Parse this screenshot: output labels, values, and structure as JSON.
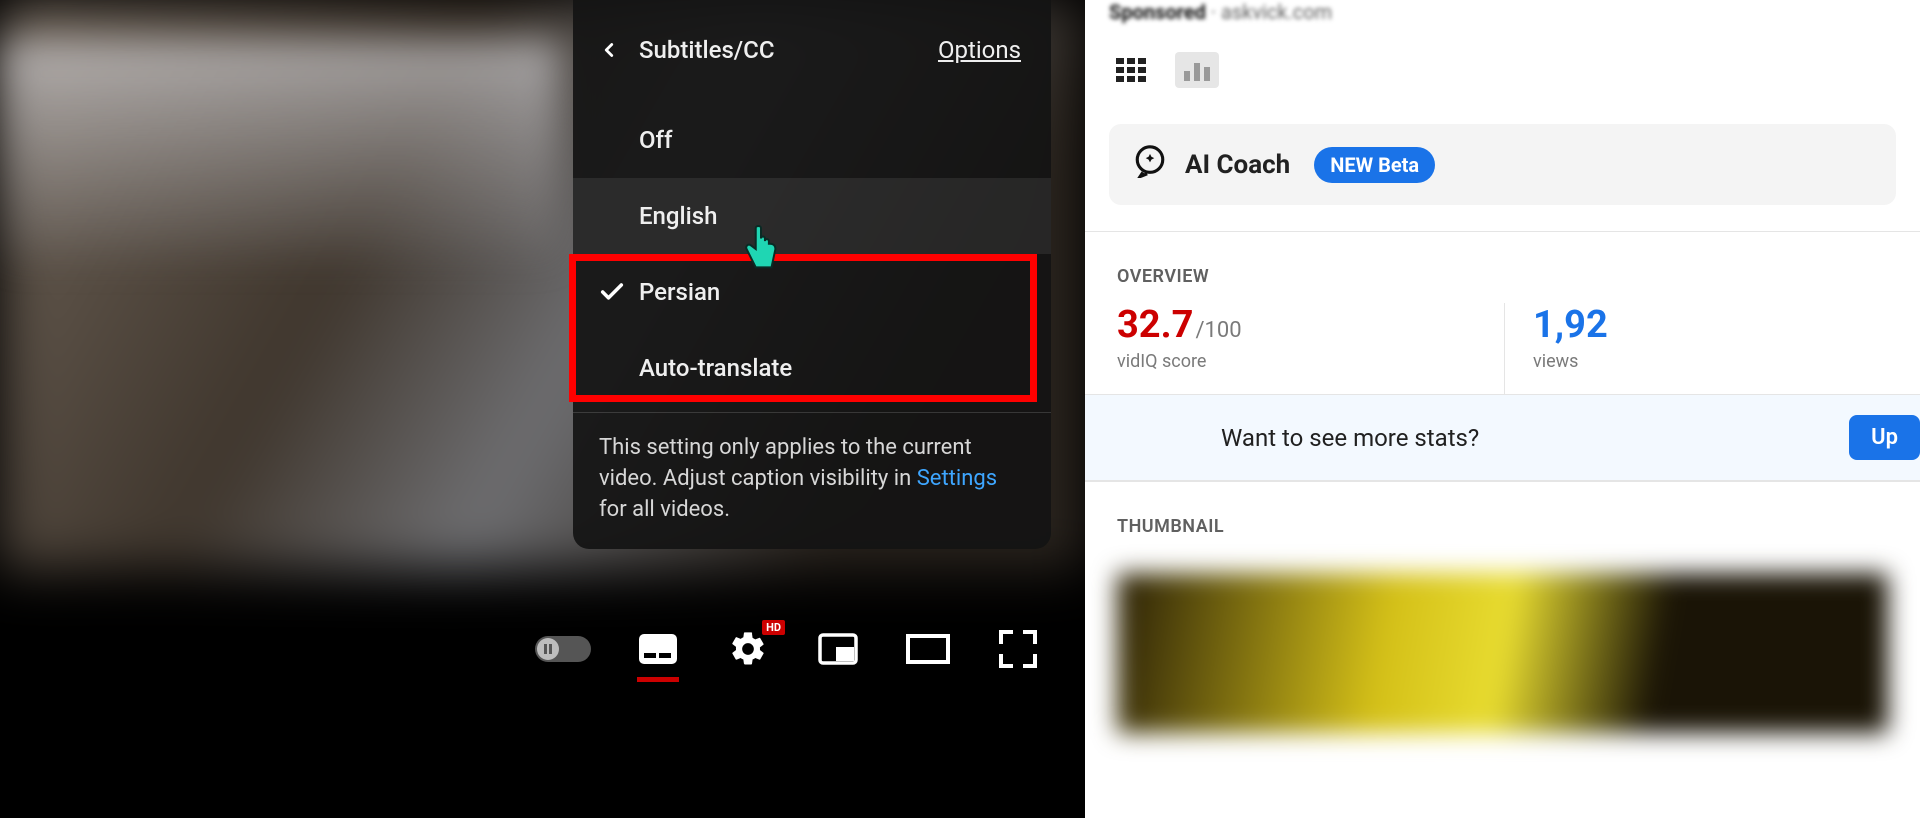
{
  "cc_menu": {
    "title": "Subtitles/CC",
    "options_link": "Options",
    "items": {
      "off": "Off",
      "english": "English",
      "persian": "Persian",
      "auto_translate": "Auto-translate"
    },
    "note_pre": "This setting only applies to the current video. Adjust caption visibility in ",
    "note_link": "Settings",
    "note_post": " for all videos."
  },
  "controls": {
    "hd": "HD"
  },
  "sidebar": {
    "sponsored_label": "Sponsored",
    "sponsored_domain": "askvick.com",
    "ai_coach": "AI Coach",
    "new_beta": "NEW Beta",
    "overview_title": "OVERVIEW",
    "score_val": "32.7",
    "score_max": "/100",
    "score_label": "vidIQ score",
    "views_val": "1,92",
    "views_label": "views",
    "upgrade_prompt": "Want to see more stats?",
    "upgrade_btn": "Up",
    "thumbnail_title": "THUMBNAIL"
  }
}
